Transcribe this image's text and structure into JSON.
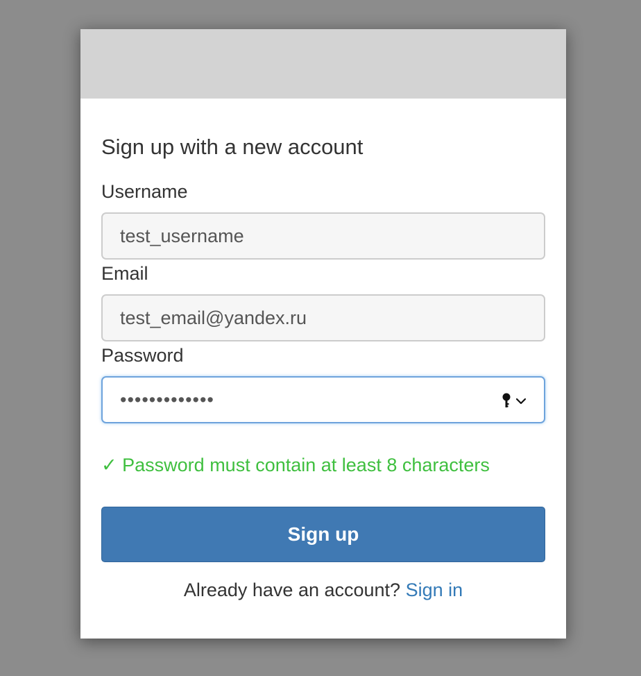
{
  "form": {
    "title": "Sign up with a new account",
    "username": {
      "label": "Username",
      "value": "test_username"
    },
    "email": {
      "label": "Email",
      "value": "test_email@yandex.ru"
    },
    "password": {
      "label": "Password",
      "masked_value": "•••••••••••••"
    },
    "validation": {
      "check_glyph": "✓",
      "message": "Password must contain at least 8 characters",
      "color": "#3fbf3f"
    },
    "submit_label": "Sign up",
    "footer": {
      "prompt": "Already have an account?",
      "link_label": "Sign in"
    }
  },
  "colors": {
    "overlay": "#8c8c8c",
    "header": "#d3d3d3",
    "primary_button": "#4079b3",
    "link": "#337ab7"
  },
  "icons": {
    "password_manager": "key-icon",
    "password_manager_dropdown": "chevron-down-icon",
    "validation_status": "check-icon"
  }
}
